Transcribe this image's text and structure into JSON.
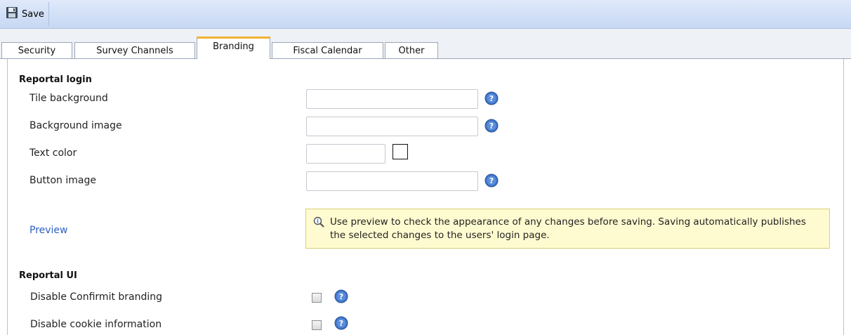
{
  "toolbar": {
    "save_label": "Save"
  },
  "tabs": [
    {
      "label": "Security",
      "active": false
    },
    {
      "label": "Survey Channels",
      "active": false
    },
    {
      "label": "Branding",
      "active": true
    },
    {
      "label": "Fiscal Calendar",
      "active": false
    },
    {
      "label": "Other",
      "active": false
    }
  ],
  "reportal_login": {
    "title": "Reportal login",
    "tile_background_label": "Tile background",
    "tile_background_value": "",
    "background_image_label": "Background image",
    "background_image_value": "",
    "text_color_label": "Text color",
    "text_color_value": "",
    "text_color_swatch": "#ffffff",
    "button_image_label": "Button image",
    "button_image_value": "",
    "preview_link": "Preview",
    "info_message": "Use preview to check the appearance of any changes before saving. Saving automatically publishes the selected changes to the users' login page."
  },
  "reportal_ui": {
    "title": "Reportal UI",
    "disable_branding_label": "Disable Confirmit branding",
    "disable_branding_checked": false,
    "disable_cookie_label": "Disable cookie information",
    "disable_cookie_checked": false
  },
  "colors": {
    "accent_tab": "#f2b233",
    "toolbar_bg": "#c7d8f3",
    "info_bg": "#fffbd0",
    "link": "#2d5fc3",
    "help_icon": "#3f74c8"
  },
  "icons": {
    "save": "floppy-disk-icon",
    "help": "question-mark-icon",
    "info": "magnifier-info-icon"
  }
}
